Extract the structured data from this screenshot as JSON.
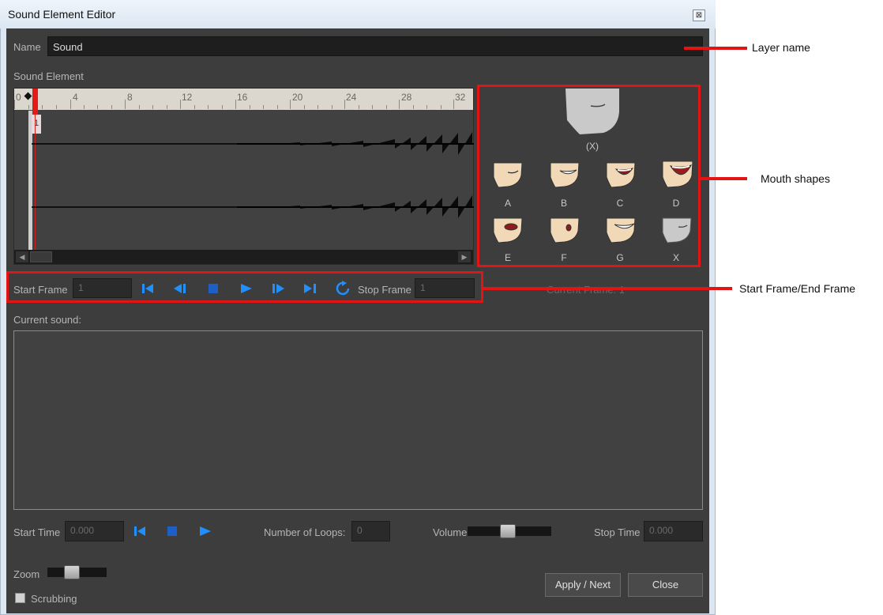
{
  "window": {
    "title": "Sound Element Editor",
    "close_glyph": "⊠"
  },
  "name_row": {
    "label": "Name",
    "value": "Sound"
  },
  "sound_element_label": "Sound Element",
  "timeline": {
    "ruler_ticks": [
      "0",
      "4",
      "8",
      "12",
      "16",
      "20",
      "24",
      "28",
      "32"
    ],
    "frame_marker": "1"
  },
  "mouth_shapes": {
    "current_label": "(X)",
    "labels": [
      "A",
      "B",
      "C",
      "D",
      "E",
      "F",
      "G",
      "X"
    ]
  },
  "transport": {
    "start_frame_label": "Start Frame",
    "start_frame_value": "1",
    "stop_frame_label": "Stop Frame",
    "stop_frame_value": "1",
    "current_frame_text": "Current Frame: 1"
  },
  "current_sound_label": "Current sound:",
  "playback": {
    "start_time_label": "Start Time",
    "start_time_value": "0.000",
    "loops_label": "Number of Loops:",
    "loops_value": "0",
    "volume_label": "Volume",
    "volume_level": 0.48,
    "stop_time_label": "Stop Time",
    "stop_time_value": "0.000"
  },
  "zoom": {
    "label": "Zoom",
    "level": 0.38
  },
  "scrubbing_label": "Scrubbing",
  "buttons": {
    "apply_next": "Apply / Next",
    "close": "Close"
  },
  "callouts": {
    "layer_name": "Layer name",
    "mouth_shapes": "Mouth shapes",
    "start_end_frame": "Start Frame/End Frame"
  },
  "colors": {
    "callout_red": "#e21414",
    "transport_blue": "#1e90ff",
    "panel_bg": "#3d3d3d"
  }
}
